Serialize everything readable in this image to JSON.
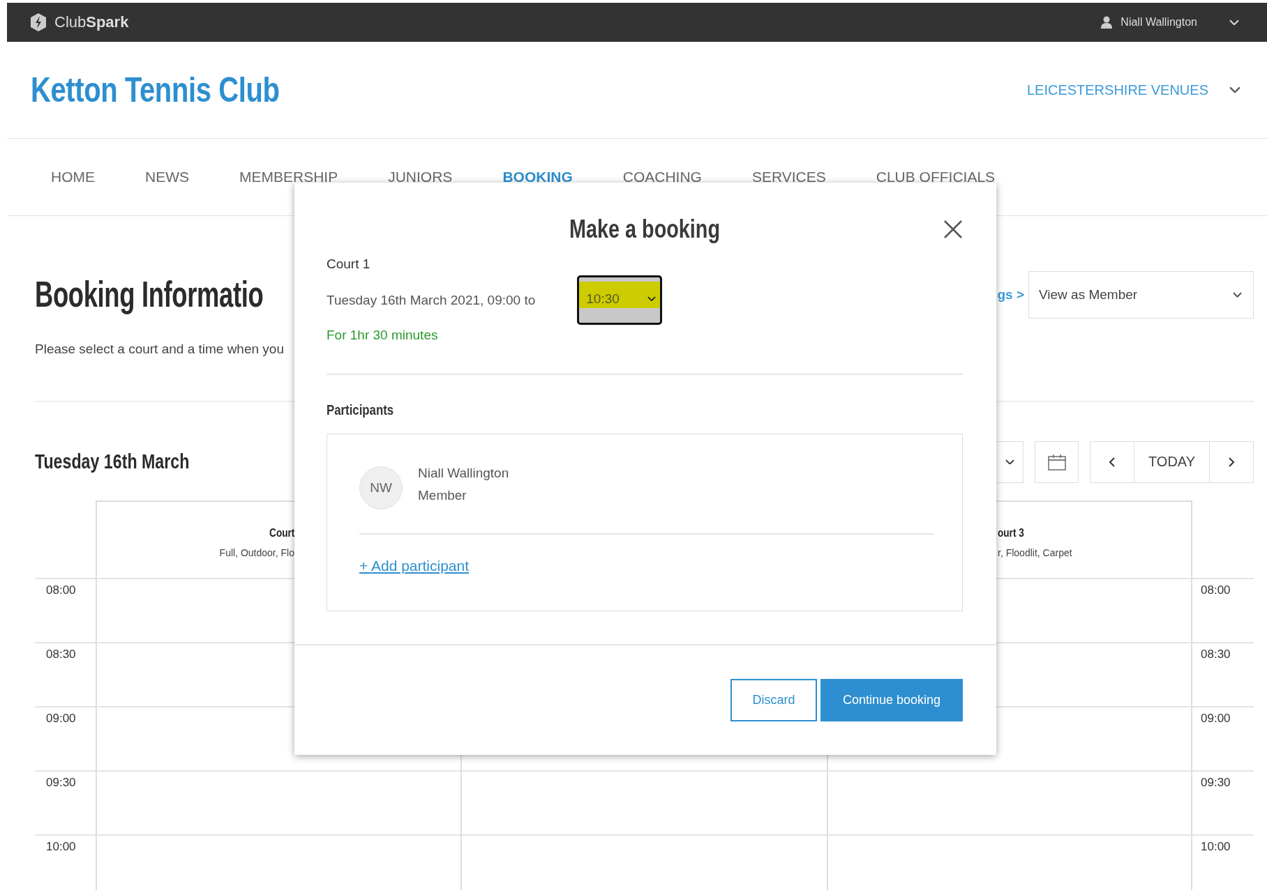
{
  "top_bar": {
    "brand": "Club**Spark**",
    "user": "Niall Wallington"
  },
  "header": {
    "club_name": "Ketton Tennis Club",
    "venues_link": "LEICESTERSHIRE VENUES"
  },
  "nav": [
    {
      "label": "HOME",
      "selected": false
    },
    {
      "label": "NEWS",
      "selected": false
    },
    {
      "label": "MEMBERSHIP",
      "selected": false
    },
    {
      "label": "JUNIORS",
      "selected": false
    },
    {
      "label": "BOOKING",
      "selected": true
    },
    {
      "label": "COACHING",
      "selected": false
    },
    {
      "label": "SERVICES",
      "selected": false
    },
    {
      "label": "CLUB OFFICIALS",
      "selected": false
    }
  ],
  "page": {
    "title": "Booking Informatio",
    "intro": "Please select a court and a time when you",
    "bookings_link": "gs >",
    "view_select": "View as Member",
    "date": "Tuesday 16th March",
    "today_button": "TODAY"
  },
  "calendar": {
    "columns": [
      {
        "kind": "cut_right",
        "name": "Court",
        "details": "Full, Outdoor, Flo"
      },
      {
        "kind": "cut_left",
        "name": "ourt 3",
        "details": "r, Floodlit, Carpet"
      }
    ],
    "rows": [
      {
        "left": "08:00",
        "right": "08:00"
      },
      {
        "left": "08:30",
        "right": "08:30"
      },
      {
        "left": "09:00",
        "right": "09:00"
      },
      {
        "left": "09:30",
        "right": "09:30"
      },
      {
        "left": "10:00",
        "right": "10:00"
      }
    ]
  },
  "modal": {
    "title": "Make a booking",
    "court": "Court 1",
    "date_range": "Tuesday 16th March 2021, 09:00 to",
    "end_time": "10:30",
    "end_time_highlighted": true,
    "duration": "For 1hr 30 minutes",
    "participants_heading": "Participants",
    "participants": [
      {
        "initials": "NW",
        "name": "Niall Wallington",
        "role": "Member"
      }
    ],
    "add_participant": "+ Add participant",
    "buttons": [
      {
        "label": "Discard",
        "kind": "secondary"
      },
      {
        "label": "Continue booking",
        "kind": "primary"
      }
    ]
  }
}
